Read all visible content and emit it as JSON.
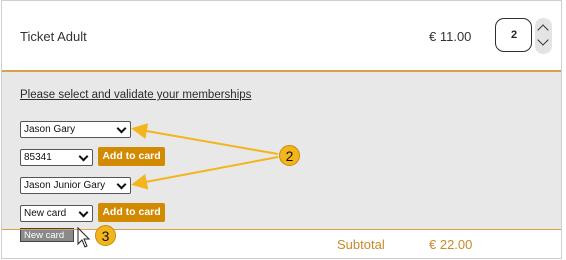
{
  "ticket": {
    "name": "Ticket Adult",
    "price": "€ 11.00",
    "quantity": "2"
  },
  "memberships": {
    "link_text": "Please select and validate your memberships",
    "rows": [
      {
        "select_value": "Jason Gary"
      },
      {
        "select_value": "85341",
        "button_label": "Add to card"
      },
      {
        "select_value": "Jason Junior Gary"
      },
      {
        "select_value": "New card",
        "button_label": "Add to card"
      }
    ],
    "dropdown_option": "New card"
  },
  "callouts": {
    "badge_2": "2",
    "badge_3": "3"
  },
  "summary": {
    "subtotal_label": "Subtotal",
    "subtotal_value": "€ 22.00"
  },
  "colors": {
    "accent": "#d28a00",
    "callout": "#f2b51e",
    "panel": "#e8e8e8"
  }
}
